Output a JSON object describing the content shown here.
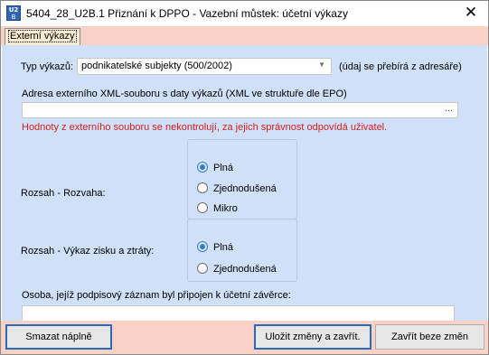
{
  "window": {
    "title": "5404_28_U2B.1 Přiznání k DPPO - Vazební můstek: účetní výkazy",
    "icon_text_top": "U2",
    "icon_text_bottom": "B"
  },
  "tabs": [
    {
      "label": "Externí výkazy",
      "active": true
    }
  ],
  "form": {
    "typ_label": "Typ výkazů:",
    "typ_value": "podnikatelské subjekty (500/2002)",
    "typ_note": "(údaj se přebírá z adresáře)",
    "xml_label": "Adresa externího XML-souboru s daty výkazů (XML ve struktuře dle EPO)",
    "xml_value": "",
    "xml_button": "...",
    "warning": "Hodnoty z externího souboru se nekontrolují, za jejich správnost odpovídá uživatel.",
    "rozvaha_label": "Rozsah - Rozvaha:",
    "rozvaha_options": [
      {
        "label": "Plná",
        "checked": true
      },
      {
        "label": "Zjednodušená",
        "checked": false
      },
      {
        "label": "Mikro",
        "checked": false
      }
    ],
    "vzz_label": "Rozsah - Výkaz zisku a ztráty:",
    "vzz_options": [
      {
        "label": "Plná",
        "checked": true
      },
      {
        "label": "Zjednodušená",
        "checked": false
      }
    ],
    "osoba_label": "Osoba, jejíž podpisový záznam byl připojen k účetní závěrce:",
    "osoba_value": ""
  },
  "footer": {
    "clear_label": "Smazat náplně",
    "save_label": "Uložit změny a zavřít.",
    "close_label": "Zavřít beze změn"
  },
  "colors": {
    "panel": "#cfe0f8",
    "accent_bar": "#fad2c5",
    "warning": "#d02020"
  }
}
